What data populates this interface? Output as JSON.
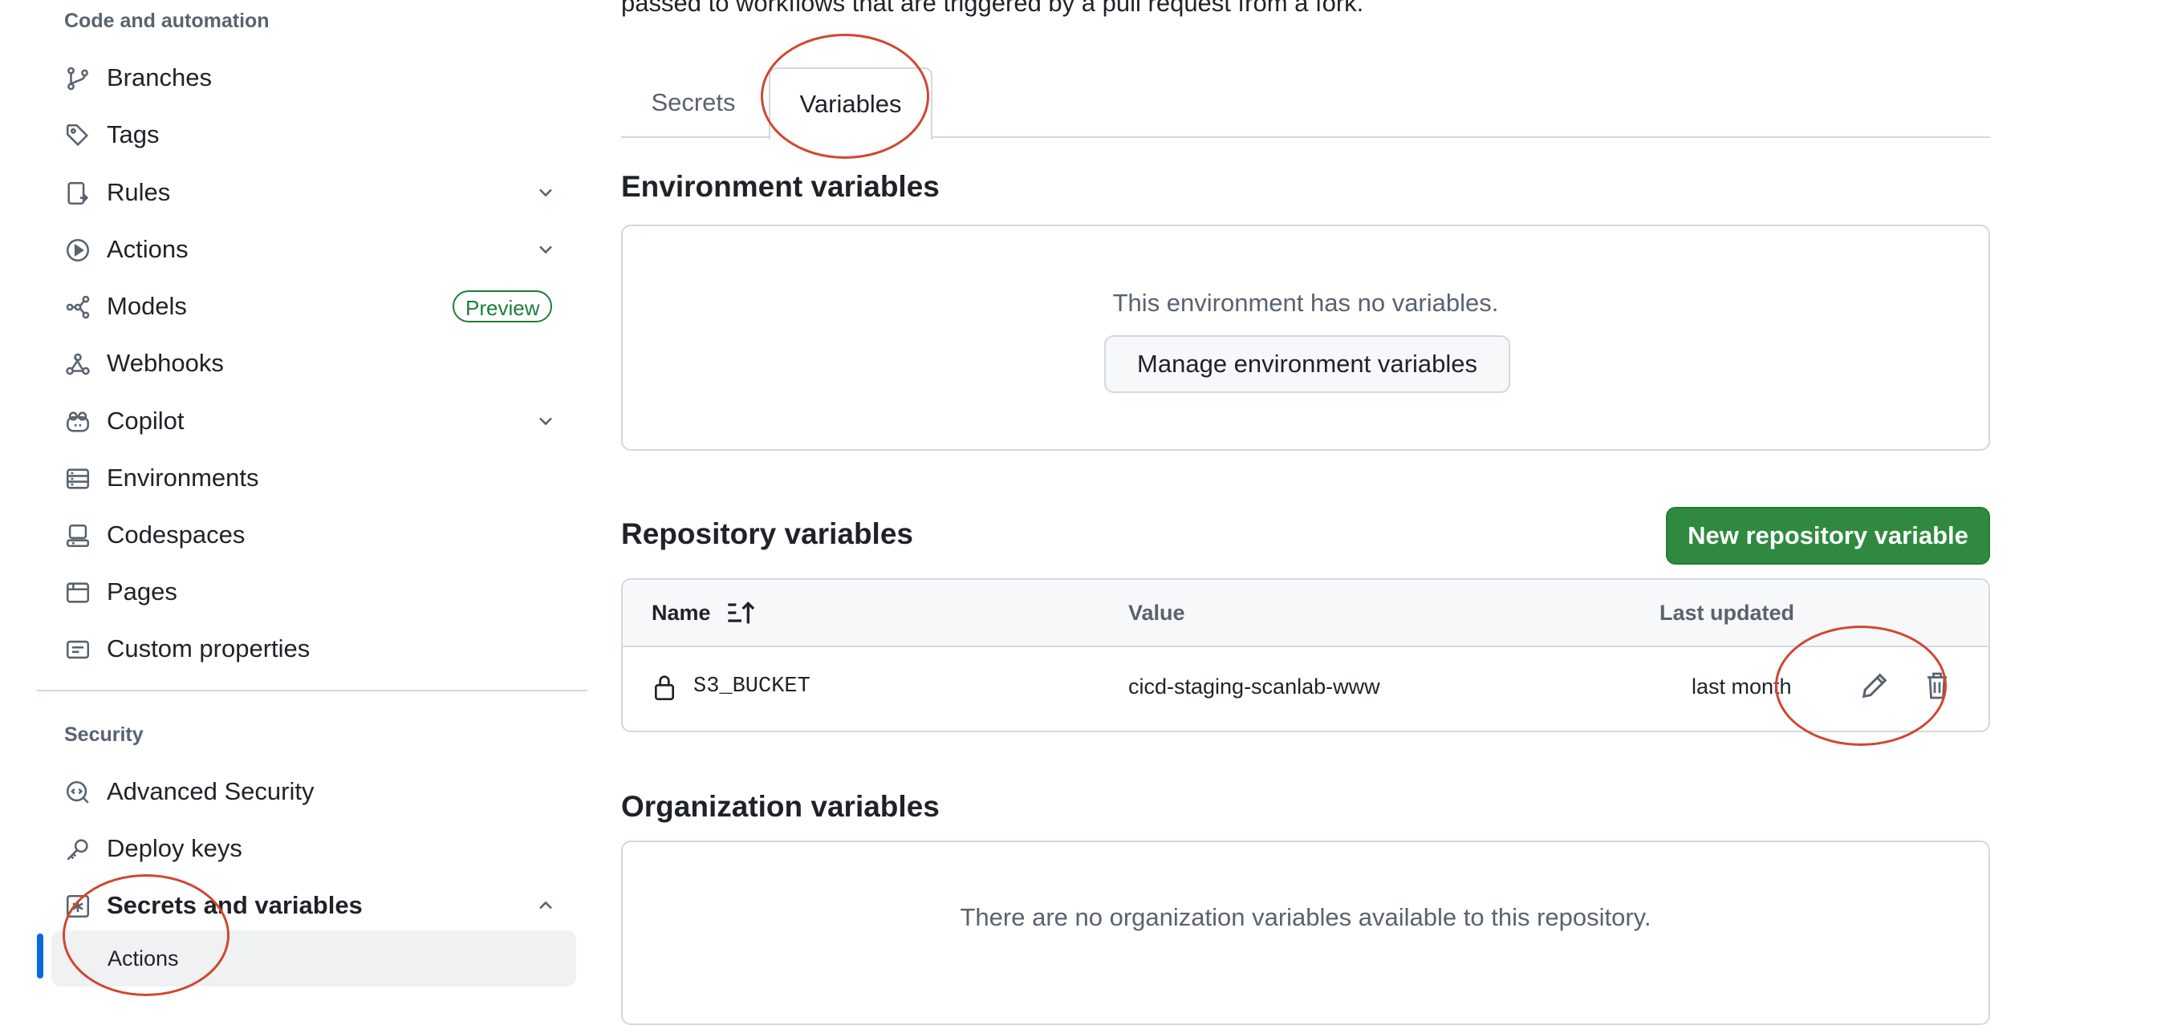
{
  "intro_text": "passed to workflows that are triggered by a pull request from a fork.",
  "sidebar": {
    "code_heading": "Code and automation",
    "code_items": [
      {
        "label": "Branches",
        "icon": "branch-icon"
      },
      {
        "label": "Tags",
        "icon": "tag-icon"
      },
      {
        "label": "Rules",
        "icon": "rules-icon",
        "expandable": true
      },
      {
        "label": "Actions",
        "icon": "play-icon",
        "expandable": true
      },
      {
        "label": "Models",
        "icon": "models-icon",
        "badge": "Preview"
      },
      {
        "label": "Webhooks",
        "icon": "webhook-icon"
      },
      {
        "label": "Copilot",
        "icon": "copilot-icon",
        "expandable": true
      },
      {
        "label": "Environments",
        "icon": "server-icon"
      },
      {
        "label": "Codespaces",
        "icon": "codespaces-icon"
      },
      {
        "label": "Pages",
        "icon": "browser-icon"
      },
      {
        "label": "Custom properties",
        "icon": "note-icon"
      }
    ],
    "security_heading": "Security",
    "security_items": [
      {
        "label": "Advanced Security",
        "icon": "codescan-icon"
      },
      {
        "label": "Deploy keys",
        "icon": "key-icon"
      },
      {
        "label": "Secrets and variables",
        "icon": "asterisk-icon",
        "expanded": true
      }
    ],
    "sub_item": "Actions"
  },
  "tabs": [
    {
      "label": "Secrets",
      "active": false
    },
    {
      "label": "Variables",
      "active": true
    }
  ],
  "environment": {
    "heading": "Environment variables",
    "empty_text": "This environment has no variables.",
    "manage_button": "Manage environment variables"
  },
  "repository": {
    "heading": "Repository variables",
    "new_button": "New repository variable",
    "columns": {
      "name": "Name",
      "value": "Value",
      "updated": "Last updated"
    },
    "rows": [
      {
        "name": "S3_BUCKET",
        "value": "cicd-staging-scanlab-www",
        "updated": "last month"
      }
    ]
  },
  "organization": {
    "heading": "Organization variables",
    "empty_text": "There are no organization variables available to this repository."
  },
  "colors": {
    "accent_green": "#2f8a3f",
    "annotation_red": "#d1472f",
    "selected_bar": "#0969da"
  }
}
